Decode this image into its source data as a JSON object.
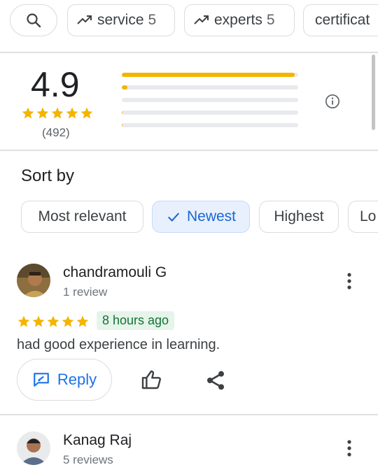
{
  "chips": [
    {
      "label": "service",
      "count": "5"
    },
    {
      "label": "experts",
      "count": "5"
    },
    {
      "label": "certificat",
      "count": ""
    }
  ],
  "summary": {
    "rating": "4.9",
    "stars": 5,
    "count": "(492)",
    "distribution": [
      0.98,
      0.03,
      0.0,
      0.005,
      0.005
    ]
  },
  "sort": {
    "label": "Sort by",
    "options": [
      "Most relevant",
      "Newest",
      "Highest",
      "Lo"
    ],
    "selected": "Newest"
  },
  "reviews": [
    {
      "name": "chandramouli G",
      "meta": "1 review",
      "stars": 5,
      "time": "8 hours ago",
      "text": "had good experience in learning.",
      "reply_label": "Reply"
    },
    {
      "name": "Kanag Raj",
      "meta": "5 reviews"
    }
  ],
  "colors": {
    "star": "#f4b400",
    "accent": "#1a73e8",
    "badge_bg": "#e6f4ea",
    "badge_text": "#137333"
  },
  "icons": [
    "search-icon",
    "trending-icon",
    "info-icon",
    "check-icon",
    "more-vert-icon",
    "reply-icon",
    "thumbs-up-icon",
    "share-icon"
  ]
}
